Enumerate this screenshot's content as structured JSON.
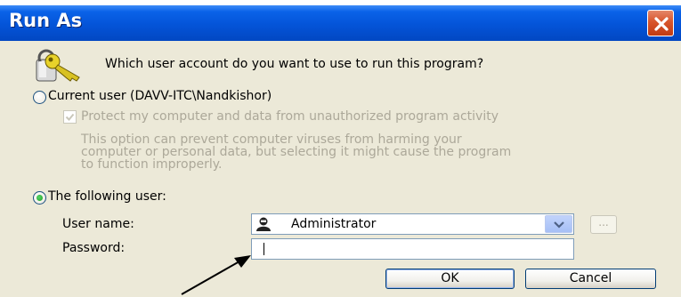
{
  "window": {
    "title": "Run As",
    "close_icon": "close-icon"
  },
  "prompt": {
    "icon": "keys-icon",
    "question": "Which user account do you want to use to run this program?"
  },
  "current_user_option": {
    "label": "Current user (DAVV-ITC\\Nandkishor)",
    "selected": false,
    "protect_checkbox": {
      "label": "Protect my computer and data from unauthorized program activity",
      "checked": true,
      "enabled": false
    },
    "info_lines": [
      "This option can prevent computer viruses from harming your",
      "computer or personal data, but selecting it might cause the program",
      "to function improperly."
    ]
  },
  "following_user_option": {
    "label": "The following user:",
    "selected": true,
    "username_label": "User name:",
    "username_value": "Administrator",
    "username_icon": "user-icon",
    "browse_label": "...",
    "password_label": "Password:",
    "password_value": ""
  },
  "buttons": {
    "ok": "OK",
    "cancel": "Cancel"
  },
  "colors": {
    "titlebar": "#0454d8",
    "dialog_background": "#ece9d8",
    "close_button": "#d8552b",
    "disabled_text": "#aca899"
  }
}
